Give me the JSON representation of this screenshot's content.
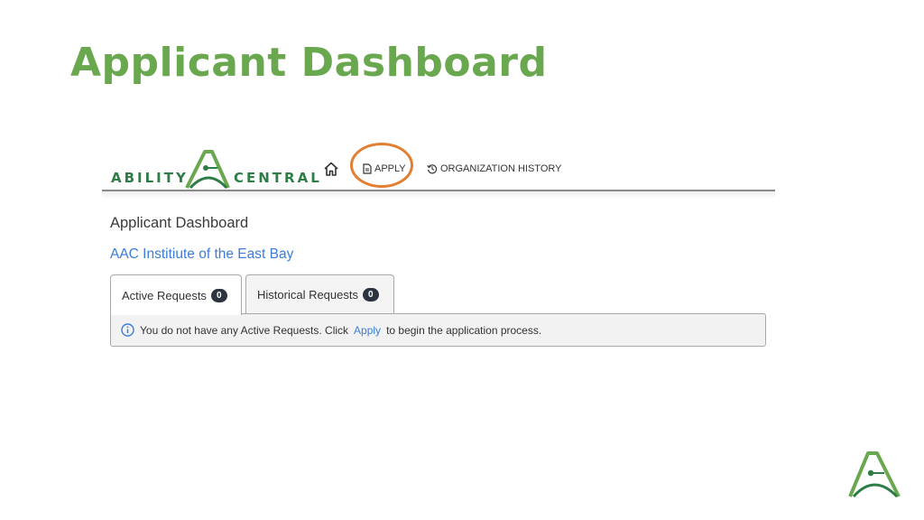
{
  "slide": {
    "title": "Applicant Dashboard"
  },
  "logo": {
    "word_left": "ABILITY",
    "word_right": "CENTRAL"
  },
  "nav": {
    "home_icon": "home-icon",
    "apply_label": "APPLY",
    "apply_icon": "document-icon",
    "history_label": "ORGANIZATION HISTORY",
    "history_icon": "history-icon"
  },
  "dashboard": {
    "title": "Applicant Dashboard",
    "org_name": "AAC Institiute of the East Bay",
    "tabs": [
      {
        "label": "Active Requests",
        "count": "0"
      },
      {
        "label": "Historical Requests",
        "count": "0"
      }
    ],
    "alert": {
      "icon": "info-icon",
      "text_before": "You do not have any Active Requests. Click",
      "link": "Apply",
      "text_after": "to begin the application process."
    }
  },
  "colors": {
    "brand_green": "#6aa84f",
    "logo_green": "#2e7d46",
    "highlight_orange": "#e37f32",
    "link_blue": "#3b7dd8"
  }
}
